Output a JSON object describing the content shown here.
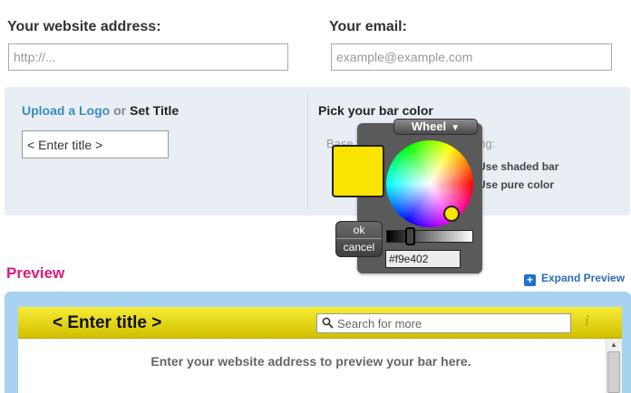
{
  "form": {
    "website_label": "Your website address:",
    "website_placeholder": "http://...",
    "email_label": "Your email:",
    "email_placeholder": "example@example.com"
  },
  "settings": {
    "upload_logo": "Upload a Logo",
    "or_word": "or",
    "set_title": "Set Title",
    "title_placeholder": "< Enter title >",
    "pick_bar_color": "Pick your bar color",
    "base_color_label": "Base color:",
    "shading_label": "Shading:",
    "use_shaded": "Use shaded bar",
    "use_pure": "Use pure color"
  },
  "color_picker": {
    "mode_label": "Wheel",
    "ok_label": "ok",
    "cancel_label": "cancel",
    "hex_value": "#f9e402",
    "selected_color": "#f9e402",
    "brightness": 0.25
  },
  "preview": {
    "heading": "Preview",
    "expand_label": "Expand Preview",
    "bar_title": "< Enter title >",
    "search_placeholder": "Search for more",
    "info_glyph": "i",
    "message": "Enter your website address to preview your bar here."
  },
  "colors": {
    "accent_pink": "#e0197a",
    "link_blue": "#3a8cc2",
    "bar_yellow": "#f9e402",
    "panel_bg": "#e9eef5",
    "frame_blue": "#a7d2f0"
  }
}
